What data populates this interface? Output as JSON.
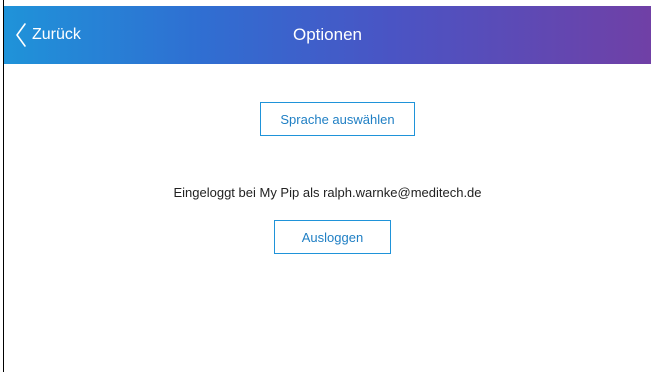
{
  "navbar": {
    "back_label": "Zurück",
    "title": "Optionen",
    "gradient_start": "#1f93d9",
    "gradient_end": "#7040a6"
  },
  "content": {
    "language_button_label": "Sprache auswählen",
    "login_status": "Eingeloggt bei My Pip als ralph.warnke@meditech.de",
    "logout_button_label": "Ausloggen"
  },
  "colors": {
    "accent": "#1f93d9",
    "text": "#222222",
    "background": "#ffffff"
  },
  "icons": {
    "back": "chevron-left-icon"
  }
}
